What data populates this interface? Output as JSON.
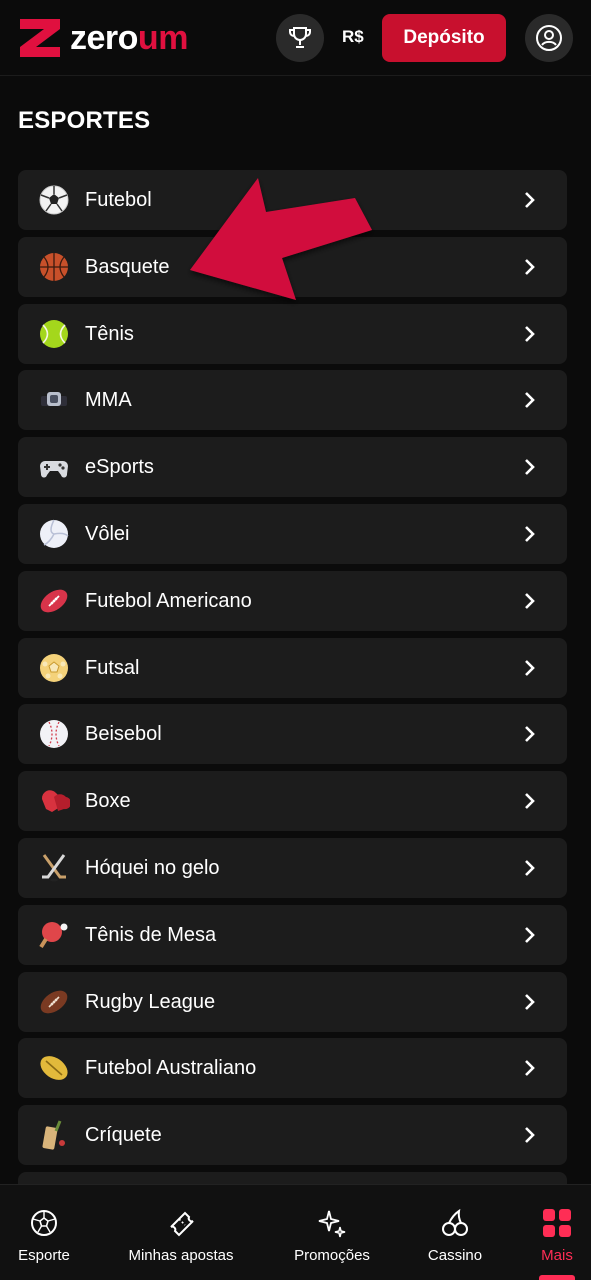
{
  "header": {
    "brand_white": "zero",
    "brand_red": "um",
    "currency": "R$",
    "deposit_label": "Depósito",
    "trophy_icon": "trophy-icon",
    "profile_icon": "user-icon"
  },
  "section_title": "ESPORTES",
  "sports": [
    {
      "label": "Futebol",
      "icon": "soccer-ball-icon"
    },
    {
      "label": "Basquete",
      "icon": "basketball-icon"
    },
    {
      "label": "Tênis",
      "icon": "tennis-ball-icon"
    },
    {
      "label": "MMA",
      "icon": "mma-belt-icon"
    },
    {
      "label": "eSports",
      "icon": "gamepad-icon"
    },
    {
      "label": "Vôlei",
      "icon": "volleyball-icon"
    },
    {
      "label": "Futebol Americano",
      "icon": "american-football-icon"
    },
    {
      "label": "Futsal",
      "icon": "futsal-ball-icon"
    },
    {
      "label": "Beisebol",
      "icon": "baseball-icon"
    },
    {
      "label": "Boxe",
      "icon": "boxing-glove-icon"
    },
    {
      "label": "Hóquei no gelo",
      "icon": "hockey-sticks-icon"
    },
    {
      "label": "Tênis de Mesa",
      "icon": "ping-pong-icon"
    },
    {
      "label": "Rugby League",
      "icon": "rugby-ball-icon"
    },
    {
      "label": "Futebol Australiano",
      "icon": "aussie-rules-ball-icon"
    },
    {
      "label": "Críquete",
      "icon": "cricket-bat-icon"
    }
  ],
  "bottom_nav": [
    {
      "label": "Esporte",
      "icon": "soccer-ball-icon",
      "active": false
    },
    {
      "label": "Minhas apostas",
      "icon": "ticket-icon",
      "active": false
    },
    {
      "label": "Promoções",
      "icon": "sparkles-icon",
      "active": false
    },
    {
      "label": "Cassino",
      "icon": "cherries-icon",
      "active": false
    },
    {
      "label": "Mais",
      "icon": "grid-icon",
      "active": true
    }
  ],
  "colors": {
    "accent": "#c8102e",
    "active_nav": "#ff2d55",
    "card_bg": "#1c1c1c",
    "background": "#0b0b0b"
  }
}
